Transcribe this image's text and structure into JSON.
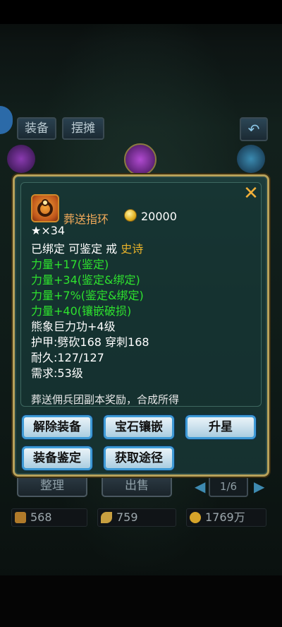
{
  "background": {
    "tabs": [
      "装备",
      "摆摊"
    ],
    "sort_button": "整理",
    "sell_button": "出售",
    "pager": "1/6",
    "resources": [
      "568",
      "759",
      "1769万"
    ]
  },
  "item": {
    "name": "葬送指环",
    "price": "20000",
    "stars": "★×34",
    "status_prefix": "已绑定 可鉴定 戒 ",
    "quality": "史诗",
    "attributes": [
      "力量+17(鉴定)",
      "力量+34(鉴定&绑定)",
      "力量+7%(鉴定&绑定)",
      "力量+40(镶嵌破损)"
    ],
    "skill": "熊象巨力功+4级",
    "armor": "护甲:劈砍168  穿刺168",
    "durability": "耐久:127/127",
    "requirement": "需求:53级",
    "description": "葬送佣兵团副本奖励，合成所得"
  },
  "actions": {
    "unequip": "解除装备",
    "gem_inlay": "宝石镶嵌",
    "star_up": "升星",
    "appraise": "装备鉴定",
    "obtain": "获取途径"
  },
  "icons": {
    "close": "close-icon",
    "coin": "gold-coin-icon",
    "item": "ring-icon"
  },
  "colors": {
    "green_attr": "#2ee22e",
    "epic": "#e8b22a",
    "item_name": "#f0a95a"
  }
}
